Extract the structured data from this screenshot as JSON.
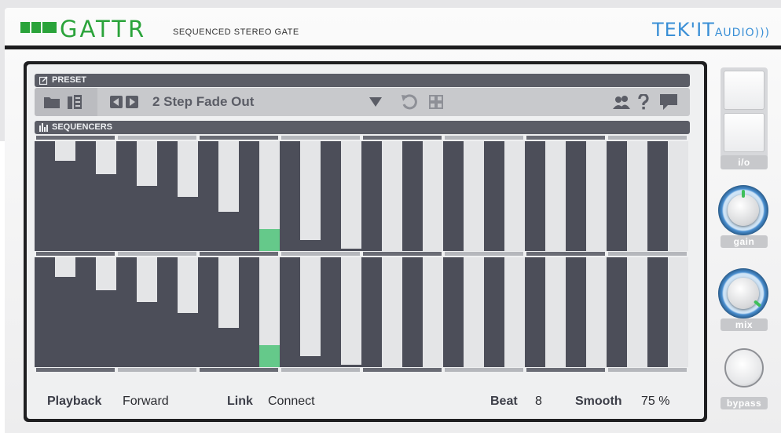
{
  "app": {
    "name": "GATTR",
    "subtitle": "SEQUENCED STEREO GATE",
    "brand": "TEK'IT",
    "brand_suffix": "AUDIO"
  },
  "preset": {
    "section_label": "PRESET",
    "name": "2 Step Fade Out"
  },
  "sequencers": {
    "section_label": "SEQUENCERS",
    "active_step": 11,
    "steps_top": [
      1.0,
      0.82,
      1.0,
      0.7,
      1.0,
      0.59,
      1.0,
      0.49,
      1.0,
      0.36,
      1.0,
      0.2,
      1.0,
      0.1,
      1.0,
      0.02,
      1.0,
      0,
      1.0,
      0,
      1.0,
      0,
      1.0,
      0,
      1.0,
      0,
      1.0,
      0,
      1.0,
      0,
      1.0,
      0
    ],
    "steps_bottom": [
      1.0,
      0.82,
      1.0,
      0.7,
      1.0,
      0.59,
      1.0,
      0.49,
      1.0,
      0.36,
      1.0,
      0.2,
      1.0,
      0.1,
      1.0,
      0.02,
      1.0,
      0,
      1.0,
      0,
      1.0,
      0,
      1.0,
      0,
      1.0,
      0,
      1.0,
      0,
      1.0,
      0,
      1.0,
      0
    ]
  },
  "status": {
    "playback_label": "Playback",
    "playback_value": "Forward",
    "link_label": "Link",
    "link_value": "Connect",
    "beat_label": "Beat",
    "beat_value": "8",
    "smooth_label": "Smooth",
    "smooth_value": "75 %"
  },
  "side": {
    "io_label": "i/o",
    "gain_label": "gain",
    "mix_label": "mix",
    "bypass_label": "bypass"
  },
  "colors": {
    "accent_green": "#2aa33a",
    "brand_blue": "#3a8fd6",
    "step_fill": "#4c4e59",
    "step_active": "#65c98a"
  }
}
